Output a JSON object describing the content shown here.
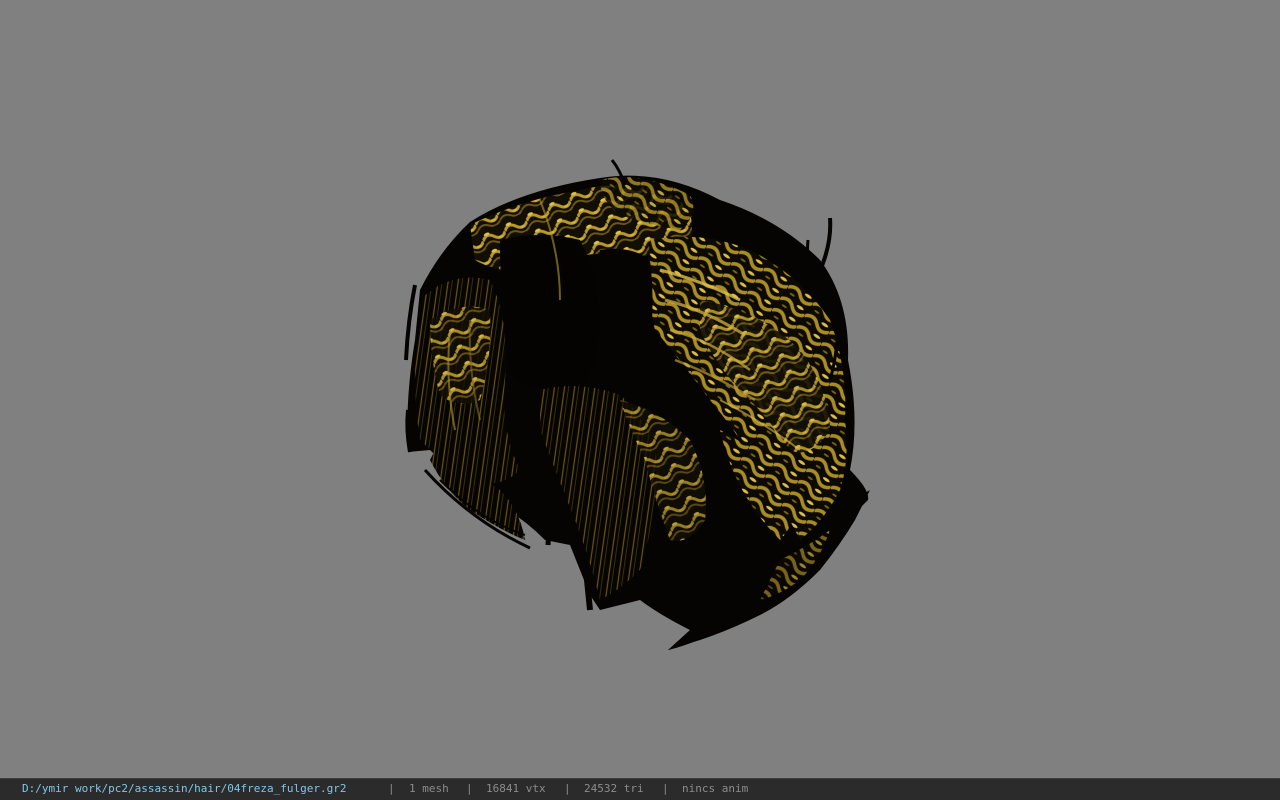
{
  "viewport": {
    "background_color": "#808080",
    "model_colors": {
      "dark": "#050402",
      "gold": "#b89a2c",
      "gold_light": "#e0c24a",
      "gold_shadow": "#5a4710"
    }
  },
  "statusbar": {
    "file_path": "D:/ymir work/pc2/assassin/hair/04freza_fulger.gr2",
    "separator": "|",
    "mesh_count": "1 mesh",
    "vertex_count": "16841 vtx",
    "triangle_count": "24532 tri",
    "anim_status": "nincs anim",
    "path_color": "#7fc6e8",
    "text_color": "#8c8c8c"
  }
}
